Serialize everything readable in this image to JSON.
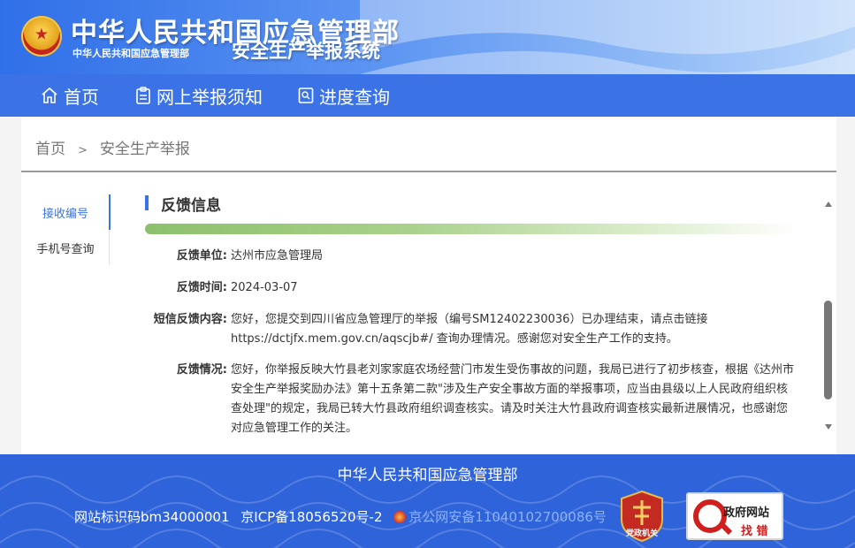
{
  "header": {
    "title": "中华人民共和国应急管理部",
    "subtitle": "中华人民共和国应急管理部",
    "system_name": "安全生产举报系统"
  },
  "nav": {
    "items": [
      {
        "label": "首页",
        "icon": "home-icon"
      },
      {
        "label": "网上举报须知",
        "icon": "clipboard-icon"
      },
      {
        "label": "进度查询",
        "icon": "search-doc-icon"
      }
    ]
  },
  "breadcrumb": {
    "home": "首页",
    "separator": ">",
    "current": "安全生产举报"
  },
  "side_tabs": [
    {
      "label": "接收编号",
      "active": true
    },
    {
      "label": "手机号查询",
      "active": false
    }
  ],
  "section": {
    "title": "反馈信息"
  },
  "feedback": {
    "unit_label": "反馈单位:",
    "unit_value": "达州市应急管理局",
    "time_label": "反馈时间:",
    "time_value": "2024-03-07",
    "sms_label": "短信反馈内容:",
    "sms_value": "您好，您提交到四川省应急管理厅的举报（编号SM12402230036）已办理结束，请点击链接https://dctjfx.mem.gov.cn/aqscjb#/ 查询办理情况。感谢您对安全生产工作的支持。",
    "situation_label": "反馈情况:",
    "situation_value": "您好，你举报反映大竹县老刘家家庭农场经营门市发生受伤事故的问题，我局已进行了初步核查，根据《达州市安全生产举报奖励办法》第十五条第二款\"涉及生产安全事故方面的举报事项，应当由县级以上人民政府组织核查处理\"的规定，我局已转大竹县政府组织调查核实。请及时关注大竹县政府调查核实最新进展情况，也感谢您对应急管理工作的关注。"
  },
  "footer": {
    "title": "中华人民共和国应急管理部",
    "site_id": "网站标识码bm34000001",
    "icp": "京ICP备18056520号-2",
    "police": "京公网安备11040102700086号",
    "party_label": "党政机关",
    "jiucuo_line1": "政府网站",
    "jiucuo_line2": "找 错"
  },
  "colors": {
    "primary": "#3b73e6",
    "footer": "#2f63d9",
    "accent_green": "#8cc06b"
  }
}
